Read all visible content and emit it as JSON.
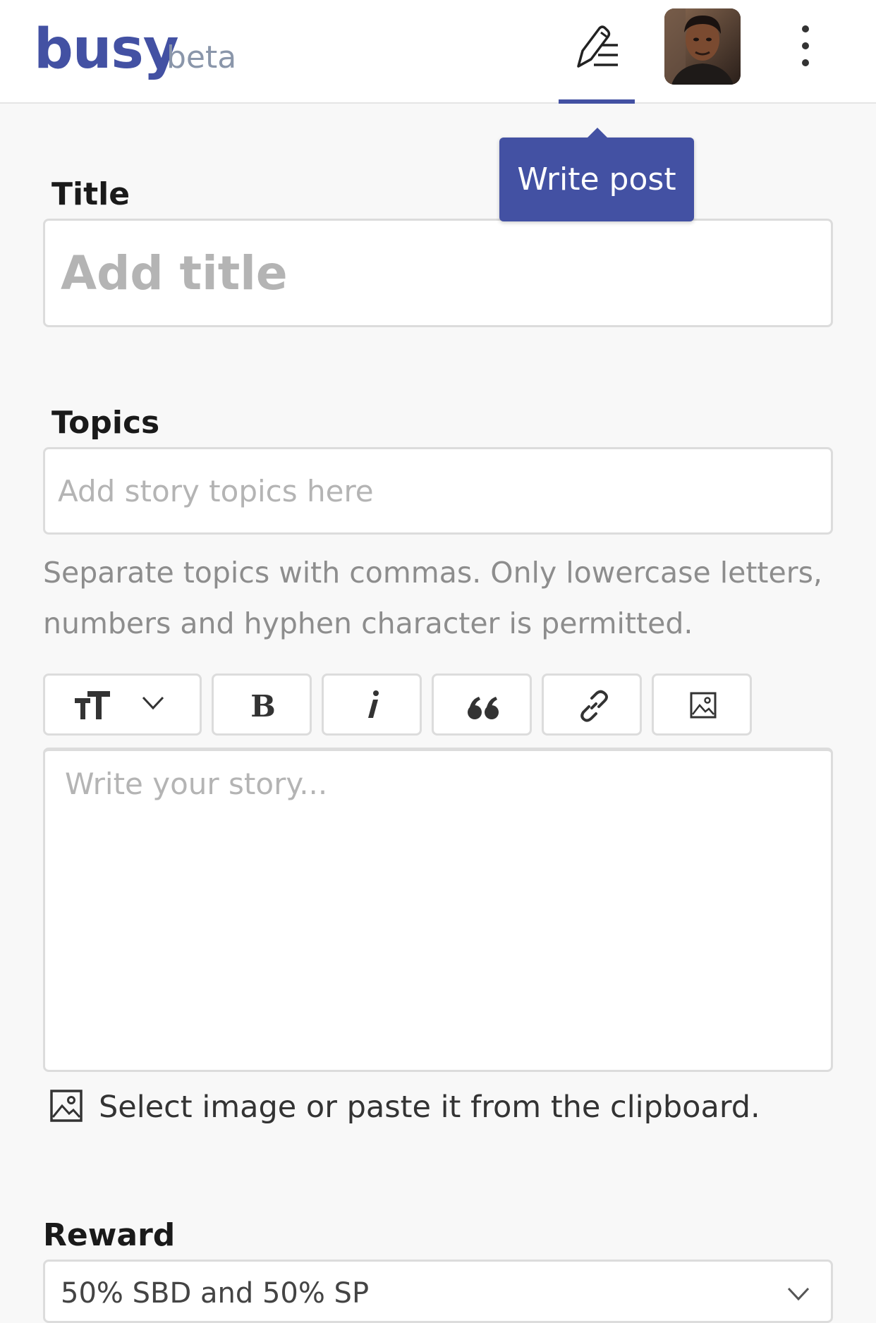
{
  "header": {
    "logo": "busy",
    "logo_badge": "beta",
    "write_tooltip": "Write post",
    "brand_color": "#4351a3"
  },
  "form": {
    "title": {
      "label": "Title",
      "placeholder": "Add title",
      "value": ""
    },
    "topics": {
      "label": "Topics",
      "placeholder": "Add story topics here",
      "value": "",
      "hint": "Separate topics with commas. Only lowercase letters, numbers and hyphen character is permitted."
    },
    "toolbar": {
      "heading": "text-size-icon",
      "bold": "B",
      "italic": "i",
      "quote": "“",
      "link": "link-icon",
      "image": "image-icon"
    },
    "story": {
      "placeholder": "Write your story...",
      "value": ""
    },
    "image_hint": "Select image or paste it from the clipboard.",
    "reward": {
      "label": "Reward",
      "selected": "50% SBD and 50% SP"
    }
  }
}
